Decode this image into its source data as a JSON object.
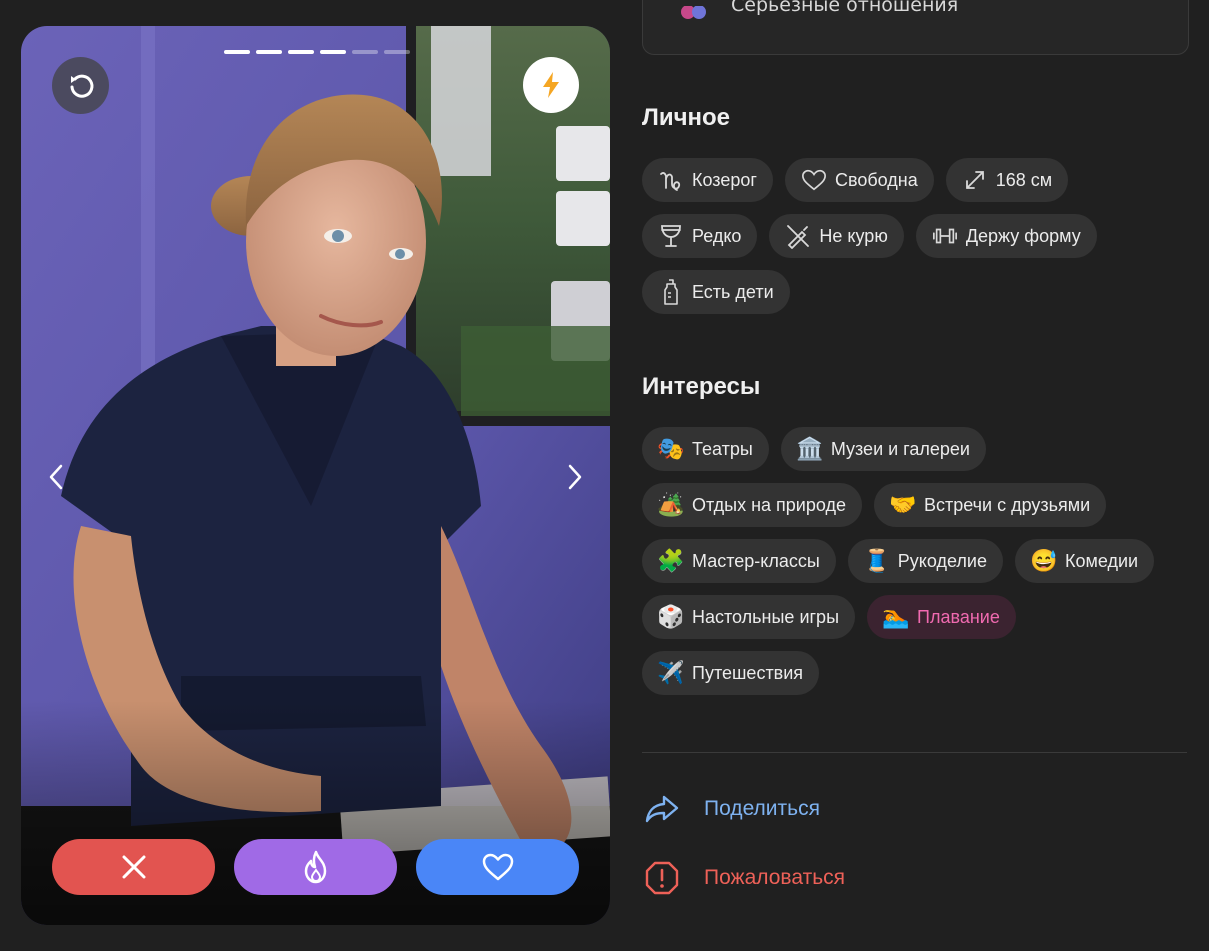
{
  "profile": {
    "photo_count": 6,
    "active_photo": 4,
    "top_peek_text": "Серьезные отношения"
  },
  "personal": {
    "title": "Личное",
    "rows": [
      [
        {
          "icon": "capricorn-icon",
          "label": "Козерог"
        },
        {
          "icon": "heart-outline-icon",
          "label": "Свободна"
        },
        {
          "icon": "resize-arrows-icon",
          "label": "168 см"
        }
      ],
      [
        {
          "icon": "wine-glass-icon",
          "label": "Редко"
        },
        {
          "icon": "no-smoking-icon",
          "label": "Не курю"
        },
        {
          "icon": "dumbbell-icon",
          "label": "Держу форму"
        }
      ],
      [
        {
          "icon": "baby-bottle-icon",
          "label": "Есть дети"
        }
      ]
    ]
  },
  "interests": {
    "title": "Интересы",
    "rows": [
      [
        {
          "icon": "theater-masks-icon",
          "emoji": "🎭",
          "label": "Театры"
        },
        {
          "icon": "museum-icon",
          "emoji": "🏛️",
          "label": "Музеи и галереи"
        }
      ],
      [
        {
          "icon": "camping-icon",
          "emoji": "🏕️",
          "label": "Отдых на природе"
        },
        {
          "icon": "handshake-icon",
          "emoji": "🤝",
          "label": "Встречи с друзьями"
        }
      ],
      [
        {
          "icon": "puzzle-icon",
          "emoji": "🧩",
          "label": "Мастер-классы"
        },
        {
          "icon": "thread-spool-icon",
          "emoji": "🧵",
          "label": "Рукоделие"
        },
        {
          "icon": "grinning-sweat-icon",
          "emoji": "😅",
          "label": "Комедии"
        }
      ],
      [
        {
          "icon": "dice-icon",
          "emoji": "🎲",
          "label": "Настольные игры"
        },
        {
          "icon": "swimming-icon",
          "emoji": "🏊",
          "label": "Плавание",
          "highlighted": true
        }
      ],
      [
        {
          "icon": "airplane-icon",
          "emoji": "✈️",
          "label": "Путешествия"
        }
      ]
    ]
  },
  "links": {
    "share": "Поделиться",
    "report": "Пожаловаться"
  },
  "colors": {
    "background": "#202020",
    "chip": "#333333",
    "nope": "#e25450",
    "superlike": "#a06ae6",
    "like": "#4a86f7",
    "share": "#7eb2f0",
    "report": "#ee6158",
    "highlight": "#f06ab0"
  }
}
